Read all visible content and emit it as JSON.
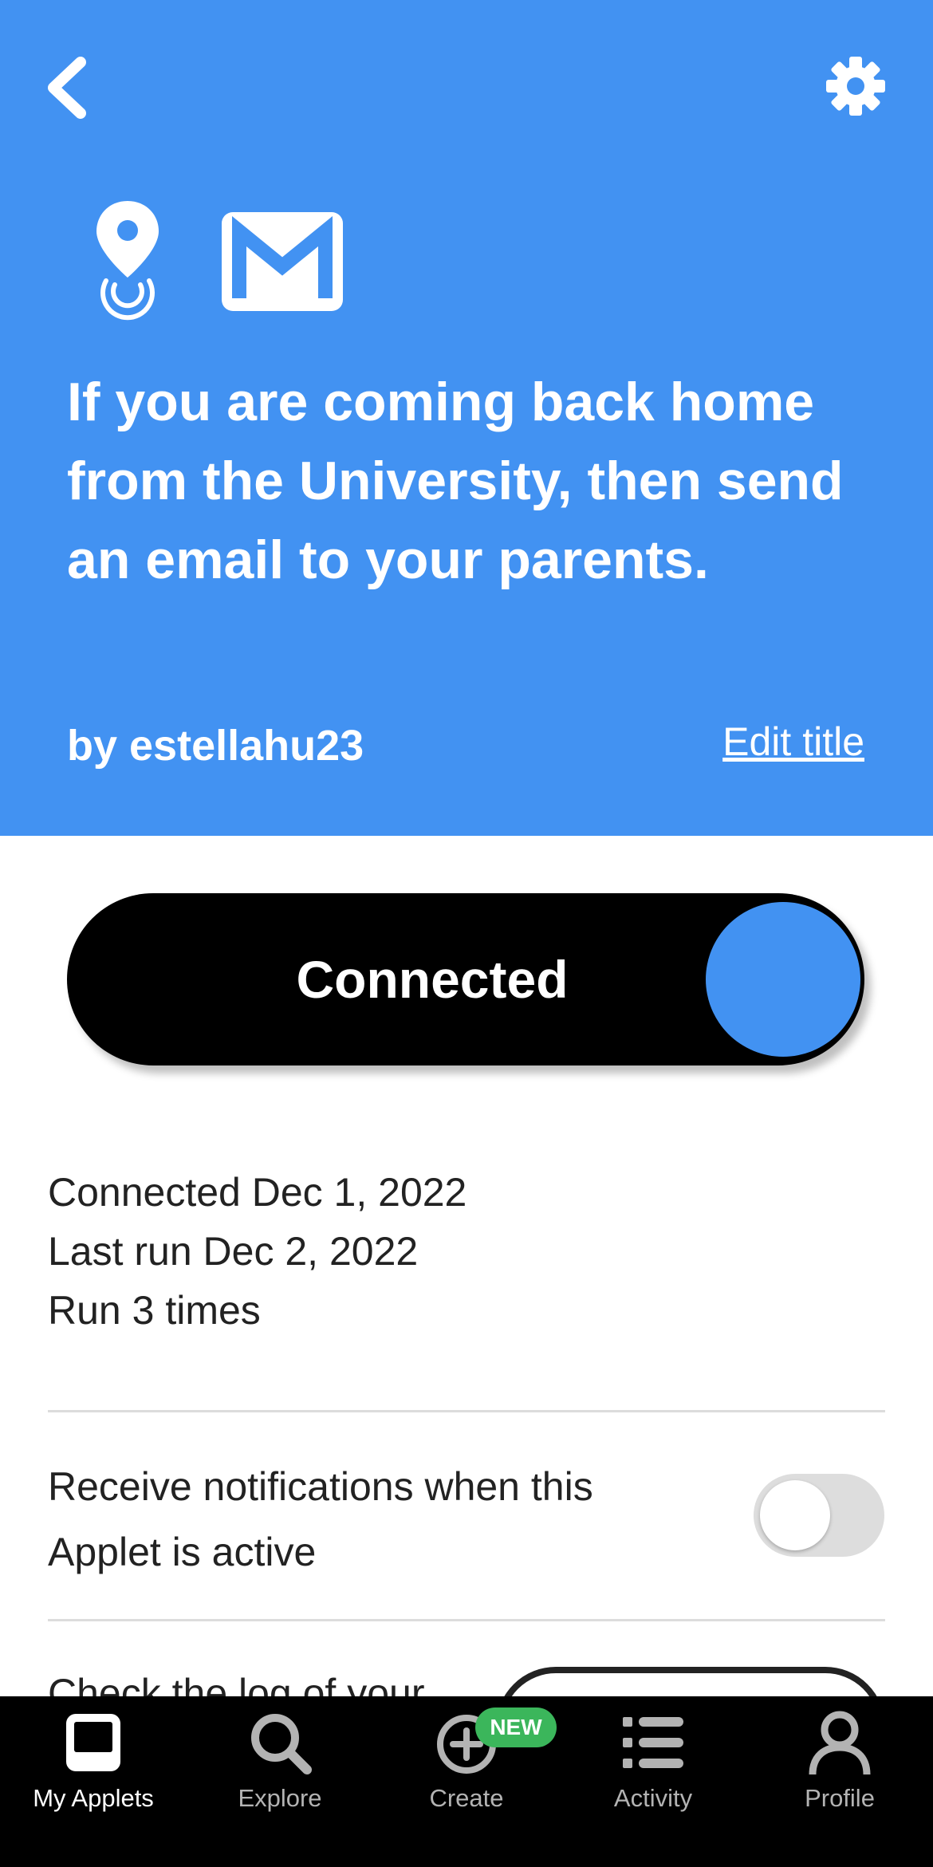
{
  "header": {
    "background_color": "#4292f2",
    "back_icon": "chevron-left-icon",
    "settings_icon": "gear-icon",
    "service_icons": [
      "location-pin-icon",
      "gmail-icon"
    ],
    "applet_title": "If you are coming back home from the University, then send an email to your parents.",
    "author": "by estellahu23",
    "edit_title_label": "Edit title"
  },
  "connection": {
    "label": "Connected",
    "state": "on",
    "knob_color": "#4292f2"
  },
  "stats": {
    "connected": "Connected Dec 1, 2022",
    "last_run": "Last run Dec 2, 2022",
    "run_count": "Run 3 times"
  },
  "notifications": {
    "label": "Receive notifications when this Applet is active",
    "enabled": false
  },
  "activity_log": {
    "label": "Check the log of your"
  },
  "tabbar": {
    "tabs": [
      {
        "label": "My Applets",
        "icon": "my-applets-icon",
        "active": true
      },
      {
        "label": "Explore",
        "icon": "search-icon",
        "active": false
      },
      {
        "label": "Create",
        "icon": "add-circle-icon",
        "active": false,
        "badge": "NEW"
      },
      {
        "label": "Activity",
        "icon": "list-icon",
        "active": false
      },
      {
        "label": "Profile",
        "icon": "person-icon",
        "active": false
      }
    ]
  }
}
